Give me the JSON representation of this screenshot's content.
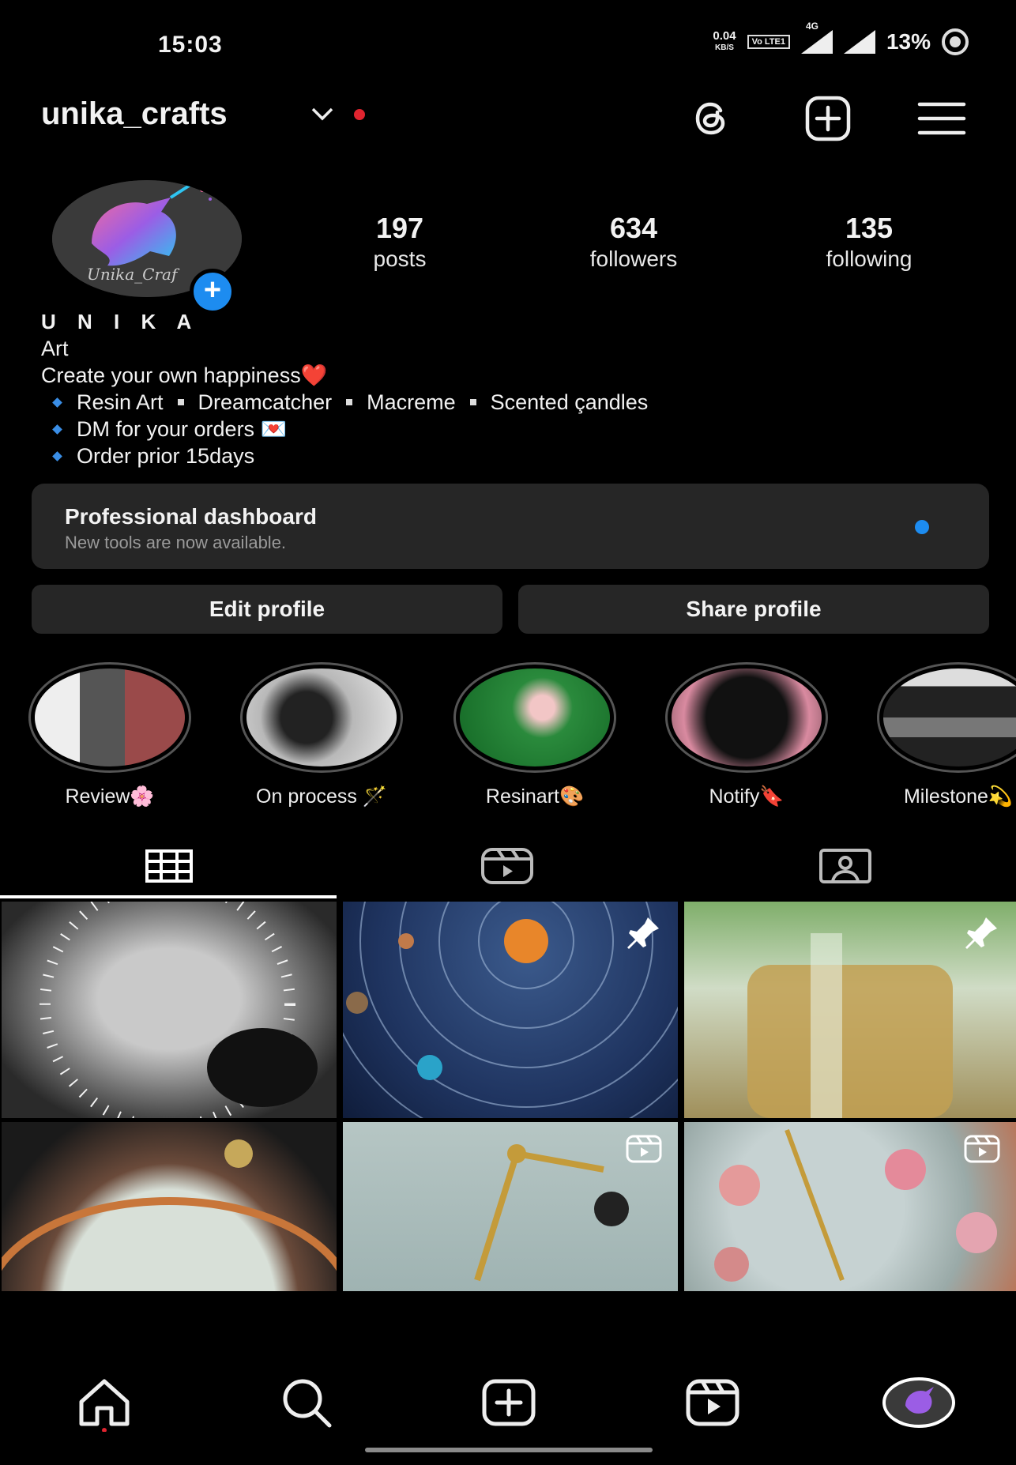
{
  "status_bar": {
    "time": "15:03",
    "net_speed_value": "0.04",
    "net_speed_unit": "KB/S",
    "volte": "Vo LTE1",
    "network": "4G",
    "battery": "13%"
  },
  "header": {
    "username": "unika_crafts",
    "icons": [
      "threads-icon",
      "new-post-icon",
      "menu-icon"
    ]
  },
  "profile": {
    "stats": [
      {
        "value": "197",
        "label": "posts"
      },
      {
        "value": "634",
        "label": "followers"
      },
      {
        "value": "135",
        "label": "following"
      }
    ],
    "avatar_text": "Unika_Craf",
    "name": "U N I K A",
    "category": "Art",
    "bio_line1": "Create your own happiness",
    "bio_heart": "❤️",
    "bio_bullets": {
      "line1": [
        "Resin Art",
        "Dreamcatcher",
        "Macreme",
        "Scented çandles"
      ],
      "line2": "DM for your orders 💌",
      "line3": "Order prior 15days"
    }
  },
  "dashboard": {
    "title": "Professional dashboard",
    "subtitle": "New tools are now available."
  },
  "buttons": {
    "edit": "Edit profile",
    "share": "Share profile"
  },
  "highlights": [
    {
      "label": "Review🌸",
      "color": "#2b2b2b"
    },
    {
      "label": "On process 🪄",
      "color": "#6b6b6b"
    },
    {
      "label": "Resinart🎨",
      "color": "#1f6b2a"
    },
    {
      "label": "Notify🔖",
      "color": "#3a2a2e"
    },
    {
      "label": "Milestone💫",
      "color": "#2e3338"
    }
  ],
  "avatar_text_tag": "Unika_Craf",
  "colors": {
    "accent": "#1d8cf0",
    "notification": "#e0242f",
    "card": "#262626"
  }
}
